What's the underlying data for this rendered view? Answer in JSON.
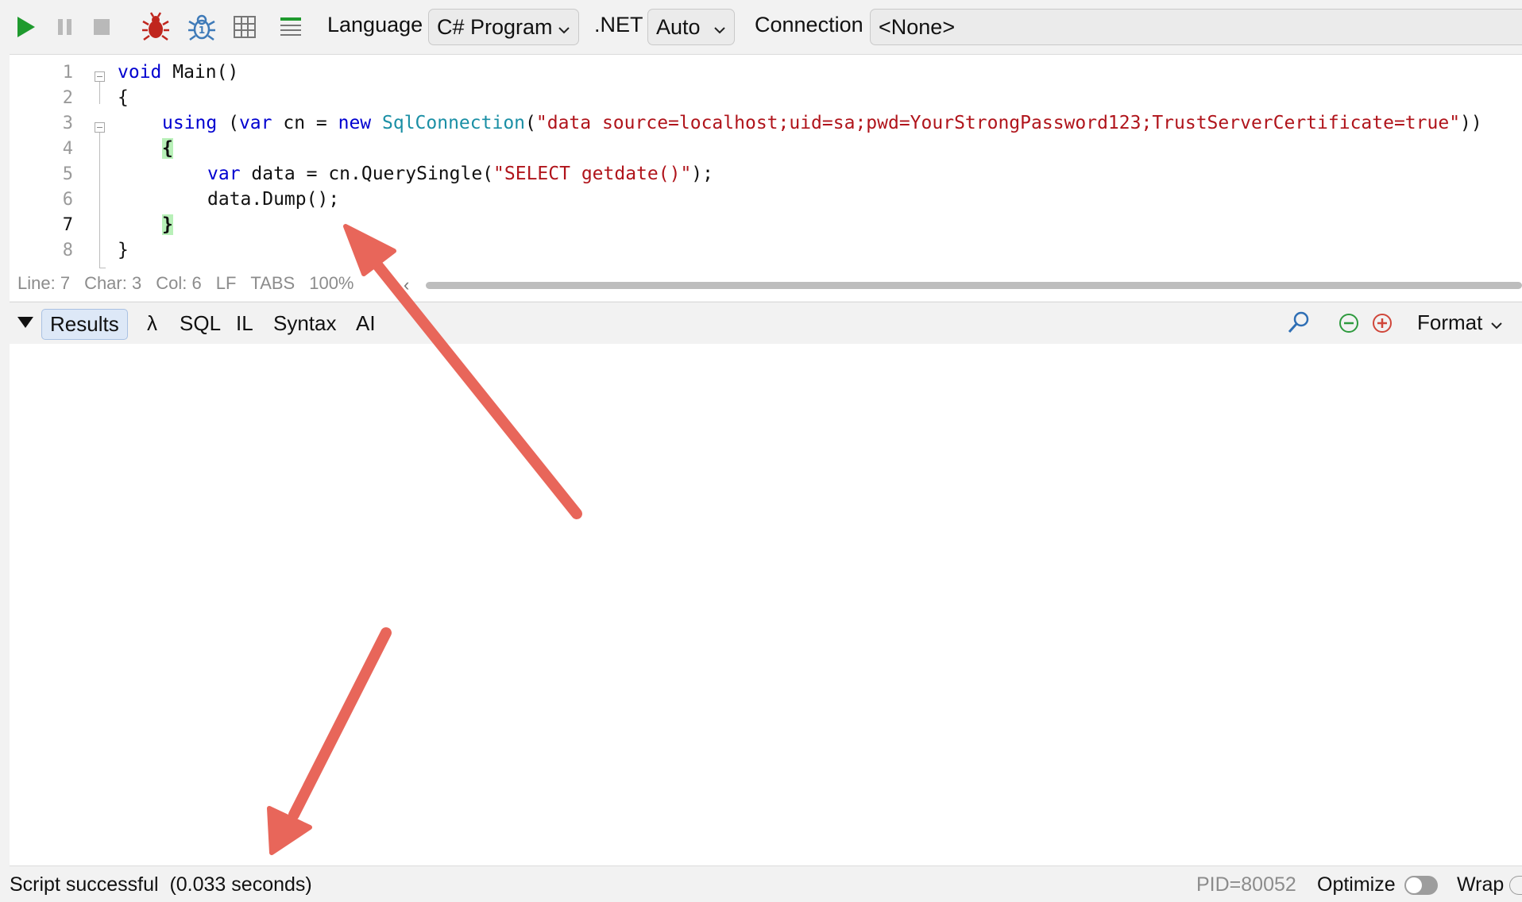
{
  "toolbar": {
    "language_label": "Language",
    "language_value": "C# Program",
    "dotnet_label": ".NET",
    "dotnet_value": "Auto",
    "connection_label": "Connection",
    "connection_value": "<None>"
  },
  "editor": {
    "line_numbers": [
      "1",
      "2",
      "3",
      "4",
      "5",
      "6",
      "7",
      "8"
    ],
    "current_line": 7,
    "code": {
      "l1_kw": "void",
      "l1_rest": " Main()",
      "l2": "{",
      "l3_kw1": "using",
      "l3_p1": " (",
      "l3_kw2": "var",
      "l3_p2": " cn = ",
      "l3_kw3": "new",
      "l3_p3": " ",
      "l3_type": "SqlConnection",
      "l3_p4": "(",
      "l3_str": "\"data source=localhost;uid=sa;pwd=YourStrongPassword123;TrustServerCertificate=true\"",
      "l3_p5": "))",
      "l4": "{",
      "l5_kw": "var",
      "l5_p1": " data = cn.QuerySingle(",
      "l5_str": "\"SELECT getdate()\"",
      "l5_p2": ");",
      "l6": "data.Dump();",
      "l7": "}",
      "l8": "}"
    },
    "status": {
      "line": "Line: 7",
      "char": "Char: 3",
      "col": "Col: 6",
      "eol": "LF",
      "indent": "TABS",
      "zoom": "100%"
    }
  },
  "results_tabs": {
    "results": "Results",
    "lambda": "λ",
    "sql": "SQL",
    "il": "IL",
    "syntax": "Syntax",
    "ai": "AI",
    "format": "Format"
  },
  "statusbar": {
    "message": "Script successful  (0.033 seconds)",
    "pid": "PID=80052",
    "optimize": "Optimize",
    "wrap": "Wrap"
  },
  "colors": {
    "keyword": "#0000d0",
    "type": "#1a8fa5",
    "string": "#b0141b",
    "annotation_arrow": "#e8665a",
    "run_green": "#1f9a2e"
  }
}
